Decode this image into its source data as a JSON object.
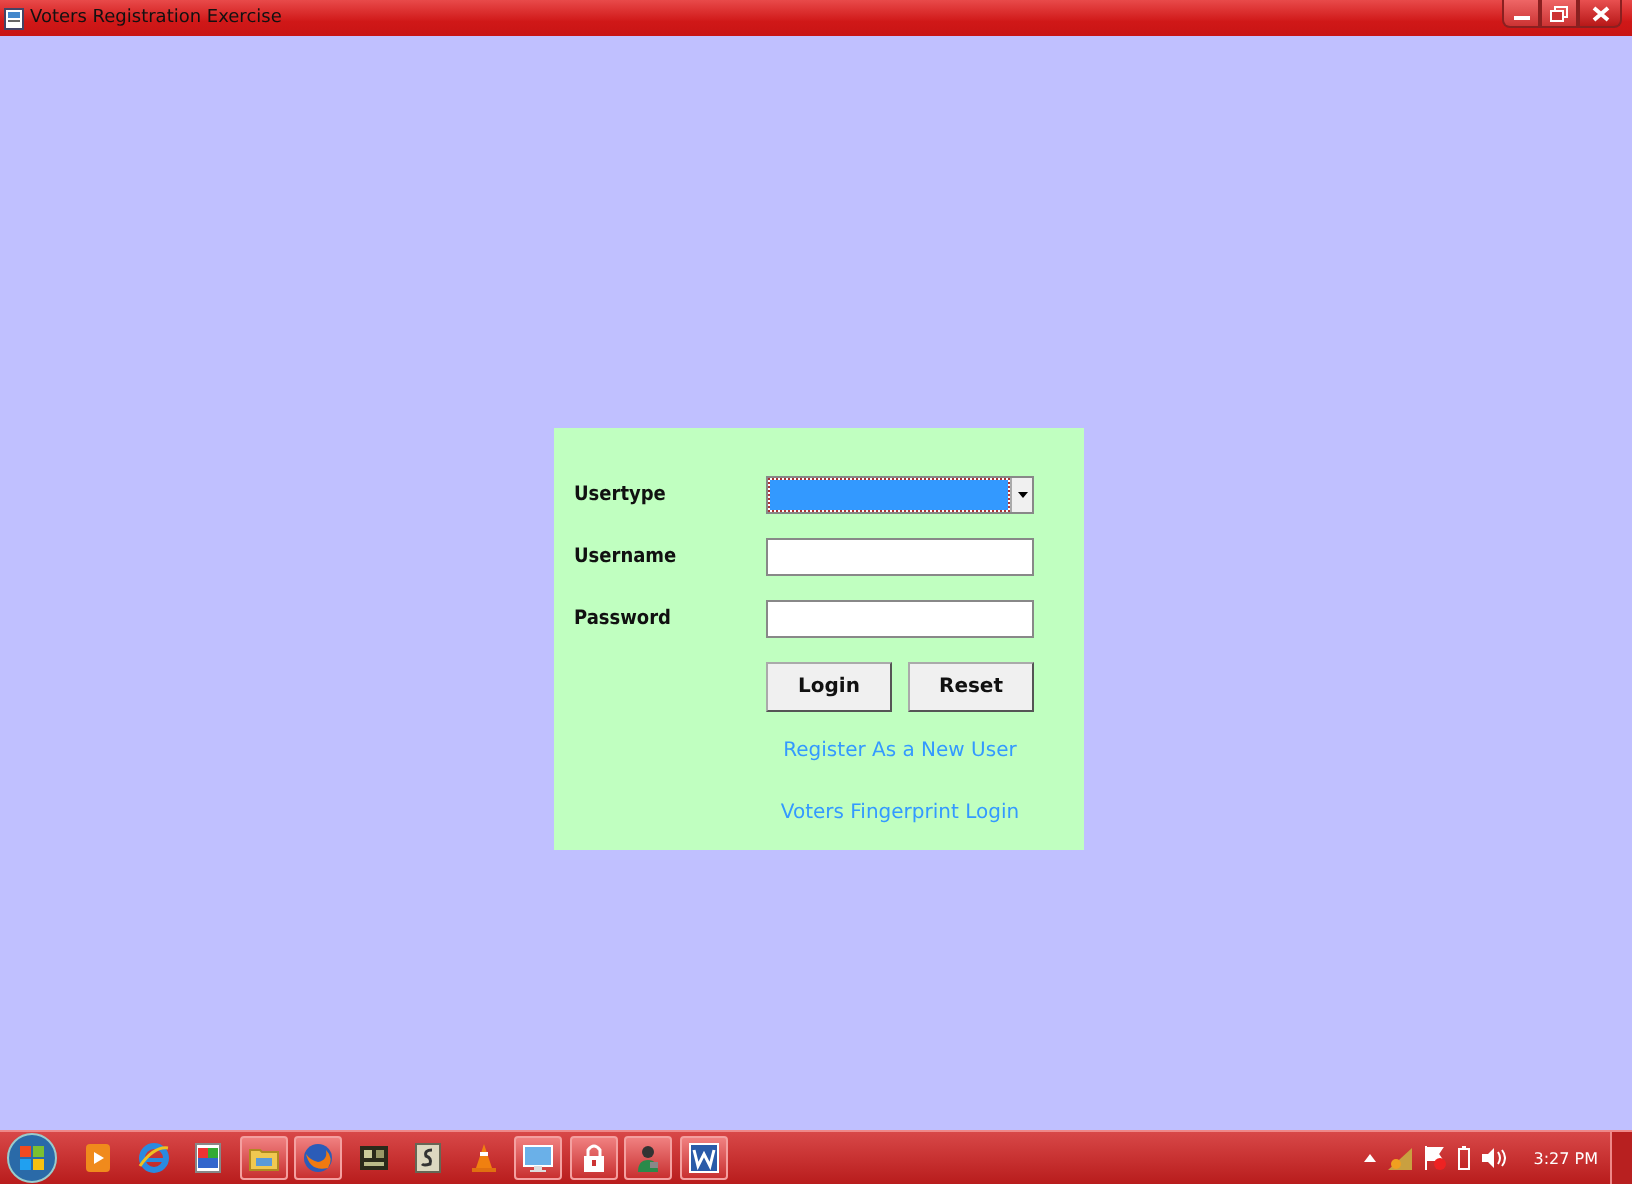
{
  "window": {
    "title": "Voters Registration Exercise"
  },
  "form": {
    "fields": [
      {
        "label": "Usertype",
        "kind": "dropdown",
        "focused": true
      },
      {
        "label": "Username",
        "kind": "text",
        "focused": false
      },
      {
        "label": "Password",
        "kind": "password",
        "focused": false
      }
    ],
    "buttons": [
      "Login",
      "Reset"
    ],
    "links": [
      "Register As a New User",
      "Voters Fingerprint Login"
    ]
  },
  "taskbar": {
    "items": [
      {
        "running": false
      },
      {
        "running": false
      },
      {
        "running": false
      },
      {
        "running": true
      },
      {
        "running": true
      },
      {
        "running": false
      },
      {
        "running": false
      },
      {
        "running": false
      },
      {
        "running": true
      },
      {
        "running": true
      },
      {
        "running": true
      },
      {
        "running": true
      }
    ],
    "clock": "3:27 PM"
  }
}
